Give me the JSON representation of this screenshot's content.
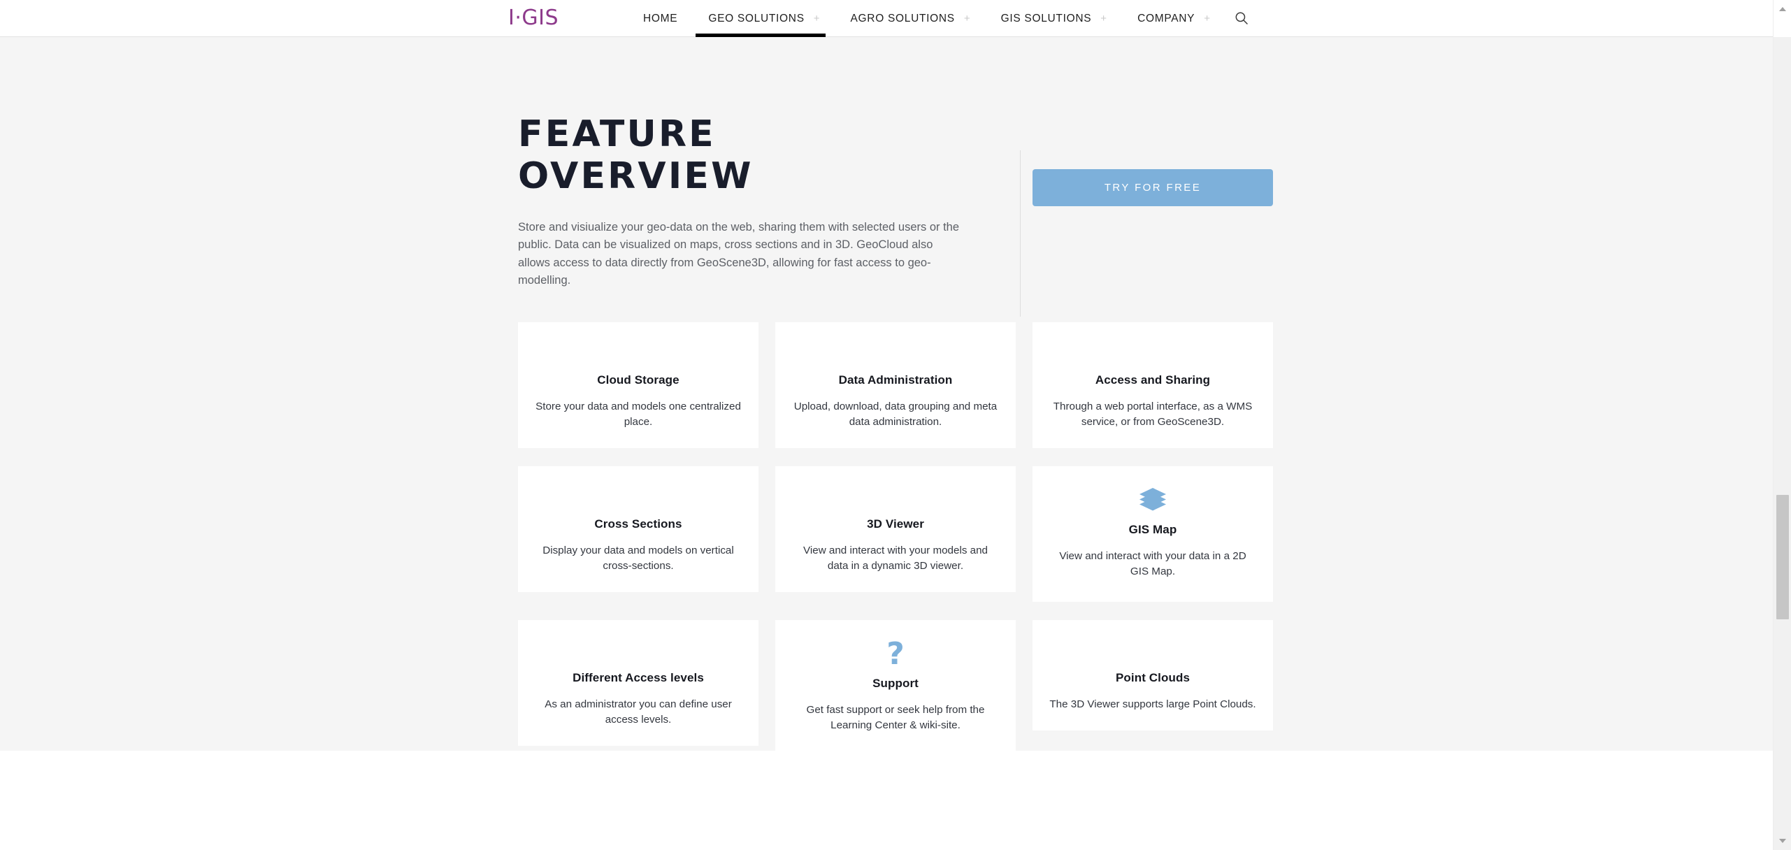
{
  "header": {
    "logo_text": "I·GIS",
    "logo_color": "#8d3a8b",
    "nav": [
      {
        "label": "HOME",
        "has_dropdown": false,
        "active": false
      },
      {
        "label": "GEO SOLUTIONS",
        "has_dropdown": true,
        "dropdown_glyph": "+",
        "active": true
      },
      {
        "label": "AGRO SOLUTIONS",
        "has_dropdown": true,
        "dropdown_glyph": "+",
        "active": false
      },
      {
        "label": "GIS SOLUTIONS",
        "has_dropdown": true,
        "dropdown_glyph": "+",
        "active": false
      },
      {
        "label": "COMPANY",
        "has_dropdown": true,
        "dropdown_glyph": "+",
        "active": false
      }
    ],
    "search_icon": "search-icon",
    "active_indicator_color": "#000000"
  },
  "hero": {
    "title_line1": "FEATURE",
    "title_line2": "OVERVIEW",
    "description": "Store and visiualize your geo-data on the web, sharing them with selected users or the public. Data can be visualized on maps, cross sections and in 3D. GeoCloud also allows access to data directly from GeoScene3D, allowing for fast access to geo-modelling.",
    "cta_label": "TRY FOR FREE",
    "cta_color": "#7db0da"
  },
  "features": [
    {
      "title": "Cloud Storage",
      "description": "Store your data and models one centralized place.",
      "icon": null
    },
    {
      "title": "Data Administration",
      "description": "Upload, download, data grouping and meta data administration.",
      "icon": null
    },
    {
      "title": "Access and Sharing",
      "description": "Through a web portal interface, as a WMS service, or from GeoScene3D.",
      "icon": null
    },
    {
      "title": "Cross Sections",
      "description": "Display your data and models on vertical cross-sections.",
      "icon": null
    },
    {
      "title": "3D Viewer",
      "description": "View and interact with your models and data in a dynamic 3D viewer.",
      "icon": null
    },
    {
      "title": "GIS Map",
      "description": "View and interact with your data in a 2D GIS Map.",
      "icon": "layers-icon",
      "icon_color": "#7db0da"
    },
    {
      "title": "Different Access levels",
      "description": "As an administrator you can define user access levels.",
      "icon": null
    },
    {
      "title": "Support",
      "description": "Get fast support or seek help from the Learning Center & wiki-site.",
      "icon": "question-mark-icon",
      "icon_glyph": "?",
      "icon_color": "#7db0da"
    },
    {
      "title": "Point Clouds",
      "description": "The 3D Viewer supports large Point Clouds.",
      "icon": null
    }
  ]
}
